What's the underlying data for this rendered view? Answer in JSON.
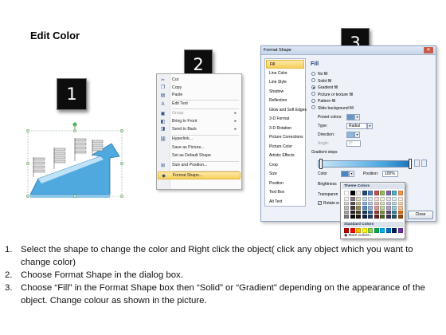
{
  "title": "Edit Color",
  "badges": [
    "1",
    "2",
    "3"
  ],
  "context_menu": {
    "items": [
      {
        "label": "Cut",
        "icon": "scissors-icon",
        "glyph": "✂",
        "disabled": false,
        "submenu": false
      },
      {
        "label": "Copy",
        "icon": "copy-icon",
        "glyph": "❐",
        "disabled": false,
        "submenu": false
      },
      {
        "label": "Paste",
        "icon": "paste-icon",
        "glyph": "▤",
        "disabled": false,
        "submenu": false
      },
      {
        "label": "Edit Text",
        "icon": "edit-text-icon",
        "glyph": "A",
        "disabled": false,
        "submenu": false
      },
      {
        "label": "Group",
        "icon": "group-icon",
        "glyph": "▣",
        "disabled": true,
        "submenu": true
      },
      {
        "label": "Bring to Front",
        "icon": "bring-front-icon",
        "glyph": "◧",
        "disabled": false,
        "submenu": true
      },
      {
        "label": "Send to Back",
        "icon": "send-back-icon",
        "glyph": "◨",
        "disabled": false,
        "submenu": true
      },
      {
        "label": "Hyperlink...",
        "icon": "hyperlink-icon",
        "glyph": "⛓",
        "disabled": false,
        "submenu": false
      },
      {
        "label": "Save as Picture...",
        "icon": "",
        "glyph": "",
        "disabled": false,
        "submenu": false
      },
      {
        "label": "Set as Default Shape",
        "icon": "",
        "glyph": "",
        "disabled": false,
        "submenu": false
      },
      {
        "label": "Size and Position...",
        "icon": "size-position-icon",
        "glyph": "⊞",
        "disabled": false,
        "submenu": false
      },
      {
        "label": "Format Shape...",
        "icon": "format-shape-icon",
        "glyph": "◆",
        "disabled": false,
        "submenu": false,
        "highlighted": true
      }
    ]
  },
  "format_dialog": {
    "title": "Format Shape",
    "categories": [
      "Fill",
      "Line Color",
      "Line Style",
      "Shadow",
      "Reflection",
      "Glow and Soft Edges",
      "3-D Format",
      "3-D Rotation",
      "Picture Corrections",
      "Picture Color",
      "Artistic Effects",
      "Crop",
      "Size",
      "Position",
      "Text Box",
      "Alt Text"
    ],
    "selected_category": "Fill",
    "pane_title": "Fill",
    "fill_options": [
      {
        "label": "No fill",
        "checked": false
      },
      {
        "label": "Solid fill",
        "checked": false
      },
      {
        "label": "Gradient fill",
        "checked": true
      },
      {
        "label": "Picture or texture fill",
        "checked": false
      },
      {
        "label": "Pattern fill",
        "checked": false
      },
      {
        "label": "Slide background fill",
        "checked": false
      }
    ],
    "preset_colors_label": "Preset colors:",
    "type_label": "Type:",
    "type_value": "Radial",
    "direction_label": "Direction:",
    "angle_label": "Angle:",
    "angle_value": "0°",
    "gradient_stops_label": "Gradient stops",
    "color_label": "Color",
    "position_label": "Position:",
    "position_value": "100%",
    "brightness_label": "Brightness",
    "transparency_label": "Transparen",
    "rotate_label": "Rotate w",
    "close_label": "Close"
  },
  "color_popup": {
    "theme_heading": "Theme Colors",
    "standard_heading": "Standard Colors",
    "more_colors": "More Colors...",
    "theme_top": [
      "#ffffff",
      "#000000",
      "#eeece1",
      "#1f497d",
      "#4f81bd",
      "#c0504d",
      "#9bbb59",
      "#8064a2",
      "#4bacc6",
      "#f79646"
    ],
    "theme_shades": [
      [
        "#f2f2f2",
        "#7f7f7f",
        "#ddd9c3",
        "#c6d9f0",
        "#dbe5f1",
        "#f2dcdb",
        "#ebf1dd",
        "#e5e0ec",
        "#dbeef3",
        "#fdeada"
      ],
      [
        "#d8d8d8",
        "#595959",
        "#c4bd97",
        "#8db3e2",
        "#b8cce4",
        "#e5b9b7",
        "#d7e3bc",
        "#ccc1d9",
        "#b7dde8",
        "#fbd5b5"
      ],
      [
        "#bfbfbf",
        "#3f3f3f",
        "#938953",
        "#548dd4",
        "#95b3d7",
        "#d99694",
        "#c3d69b",
        "#b2a2c7",
        "#92cddc",
        "#fac08f"
      ],
      [
        "#a5a5a5",
        "#262626",
        "#494429",
        "#17365d",
        "#366092",
        "#953734",
        "#76923c",
        "#5f497a",
        "#31859b",
        "#e36c09"
      ],
      [
        "#7f7f7f",
        "#0c0c0c",
        "#1d1b10",
        "#0f243e",
        "#244061",
        "#632423",
        "#4f6128",
        "#3f3151",
        "#205867",
        "#974806"
      ]
    ],
    "standard": [
      "#c00000",
      "#ff0000",
      "#ffc000",
      "#ffff00",
      "#92d050",
      "#00b050",
      "#00b0f0",
      "#0070c0",
      "#002060",
      "#7030a0"
    ]
  },
  "instructions": [
    {
      "num": "1.",
      "text": "Select the shape to change the color and Right click the object( click any object which you want to change color)"
    },
    {
      "num": "2.",
      "text": "Choose Format Shape in the dialog box."
    },
    {
      "num": "3.",
      "text": "Choose “Fill” in the Format Shape box then “Solid” or “Gradient” depending on the appearance of the object. Change colour as shown in the picture."
    }
  ]
}
